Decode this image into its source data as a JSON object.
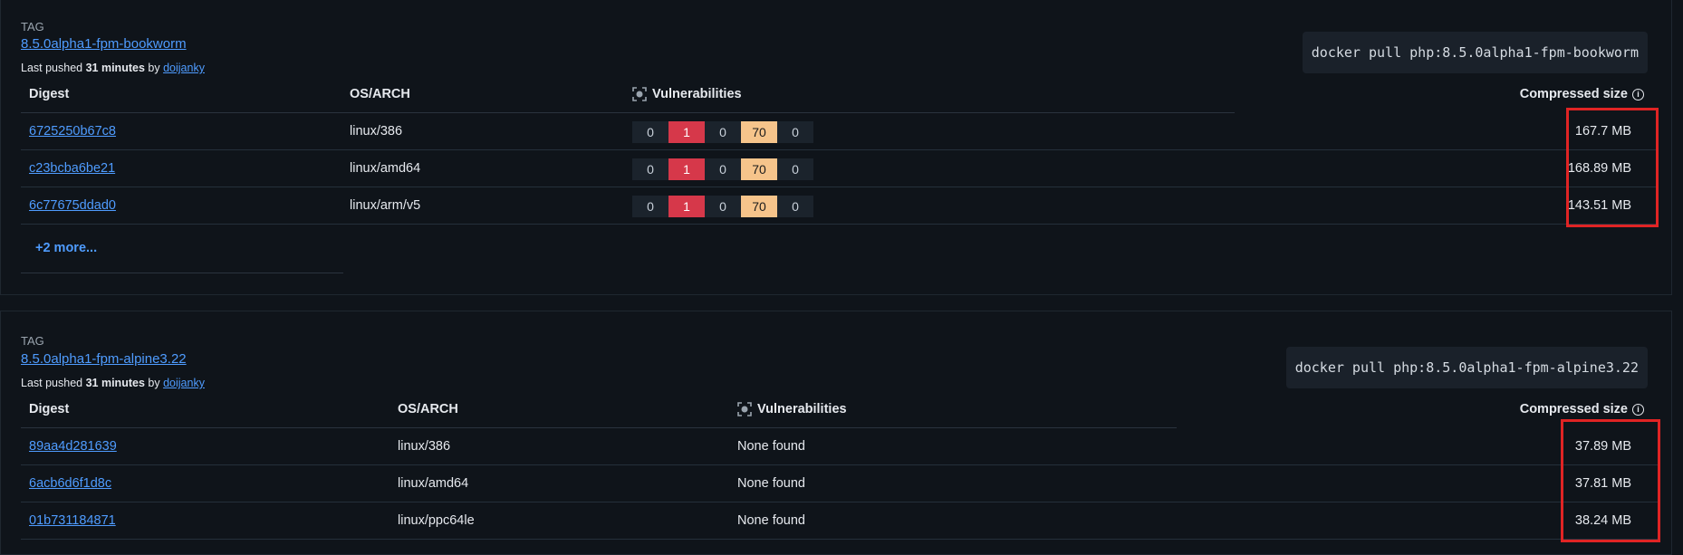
{
  "tags": [
    {
      "tag_label": "TAG",
      "name": "8.5.0alpha1-fpm-bookworm",
      "pushed_prefix": "Last pushed",
      "pushed_time": "31 minutes",
      "pushed_by": "by",
      "user": "doijanky",
      "command": "docker pull php:8.5.0alpha1-fpm-bookworm",
      "columns": {
        "digest": "Digest",
        "osarch": "OS/ARCH",
        "vulns": "Vulnerabilities",
        "size": "Compressed size"
      },
      "rows": [
        {
          "digest": "6725250b67c8",
          "osarch": "linux/386",
          "vulns": [
            "0",
            "1",
            "0",
            "70",
            "0"
          ],
          "size": "167.7 MB"
        },
        {
          "digest": "c23bcba6be21",
          "osarch": "linux/amd64",
          "vulns": [
            "0",
            "1",
            "0",
            "70",
            "0"
          ],
          "size": "168.89 MB"
        },
        {
          "digest": "6c77675ddad0",
          "osarch": "linux/arm/v5",
          "vulns": [
            "0",
            "1",
            "0",
            "70",
            "0"
          ],
          "size": "143.51 MB"
        }
      ],
      "more": "+2 more..."
    },
    {
      "tag_label": "TAG",
      "name": "8.5.0alpha1-fpm-alpine3.22",
      "pushed_prefix": "Last pushed",
      "pushed_time": "31 minutes",
      "pushed_by": "by",
      "user": "doijanky",
      "command": "docker pull php:8.5.0alpha1-fpm-alpine3.22",
      "columns": {
        "digest": "Digest",
        "osarch": "OS/ARCH",
        "vulns": "Vulnerabilities",
        "size": "Compressed size"
      },
      "rows": [
        {
          "digest": "89aa4d281639",
          "osarch": "linux/386",
          "vulns": "None found",
          "size": "37.89 MB"
        },
        {
          "digest": "6acb6d6f1d8c",
          "osarch": "linux/amd64",
          "vulns": "None found",
          "size": "37.81 MB"
        },
        {
          "digest": "01b731184871",
          "osarch": "linux/ppc64le",
          "vulns": "None found",
          "size": "38.24 MB"
        }
      ]
    }
  ],
  "colors": {
    "link": "#4f9cff",
    "critical": "#d6384a",
    "medium": "#f6c48b",
    "highlight": "#e02424"
  },
  "icons": {
    "vulnerabilities": "scan-target-icon",
    "info": "info-circle-icon"
  }
}
